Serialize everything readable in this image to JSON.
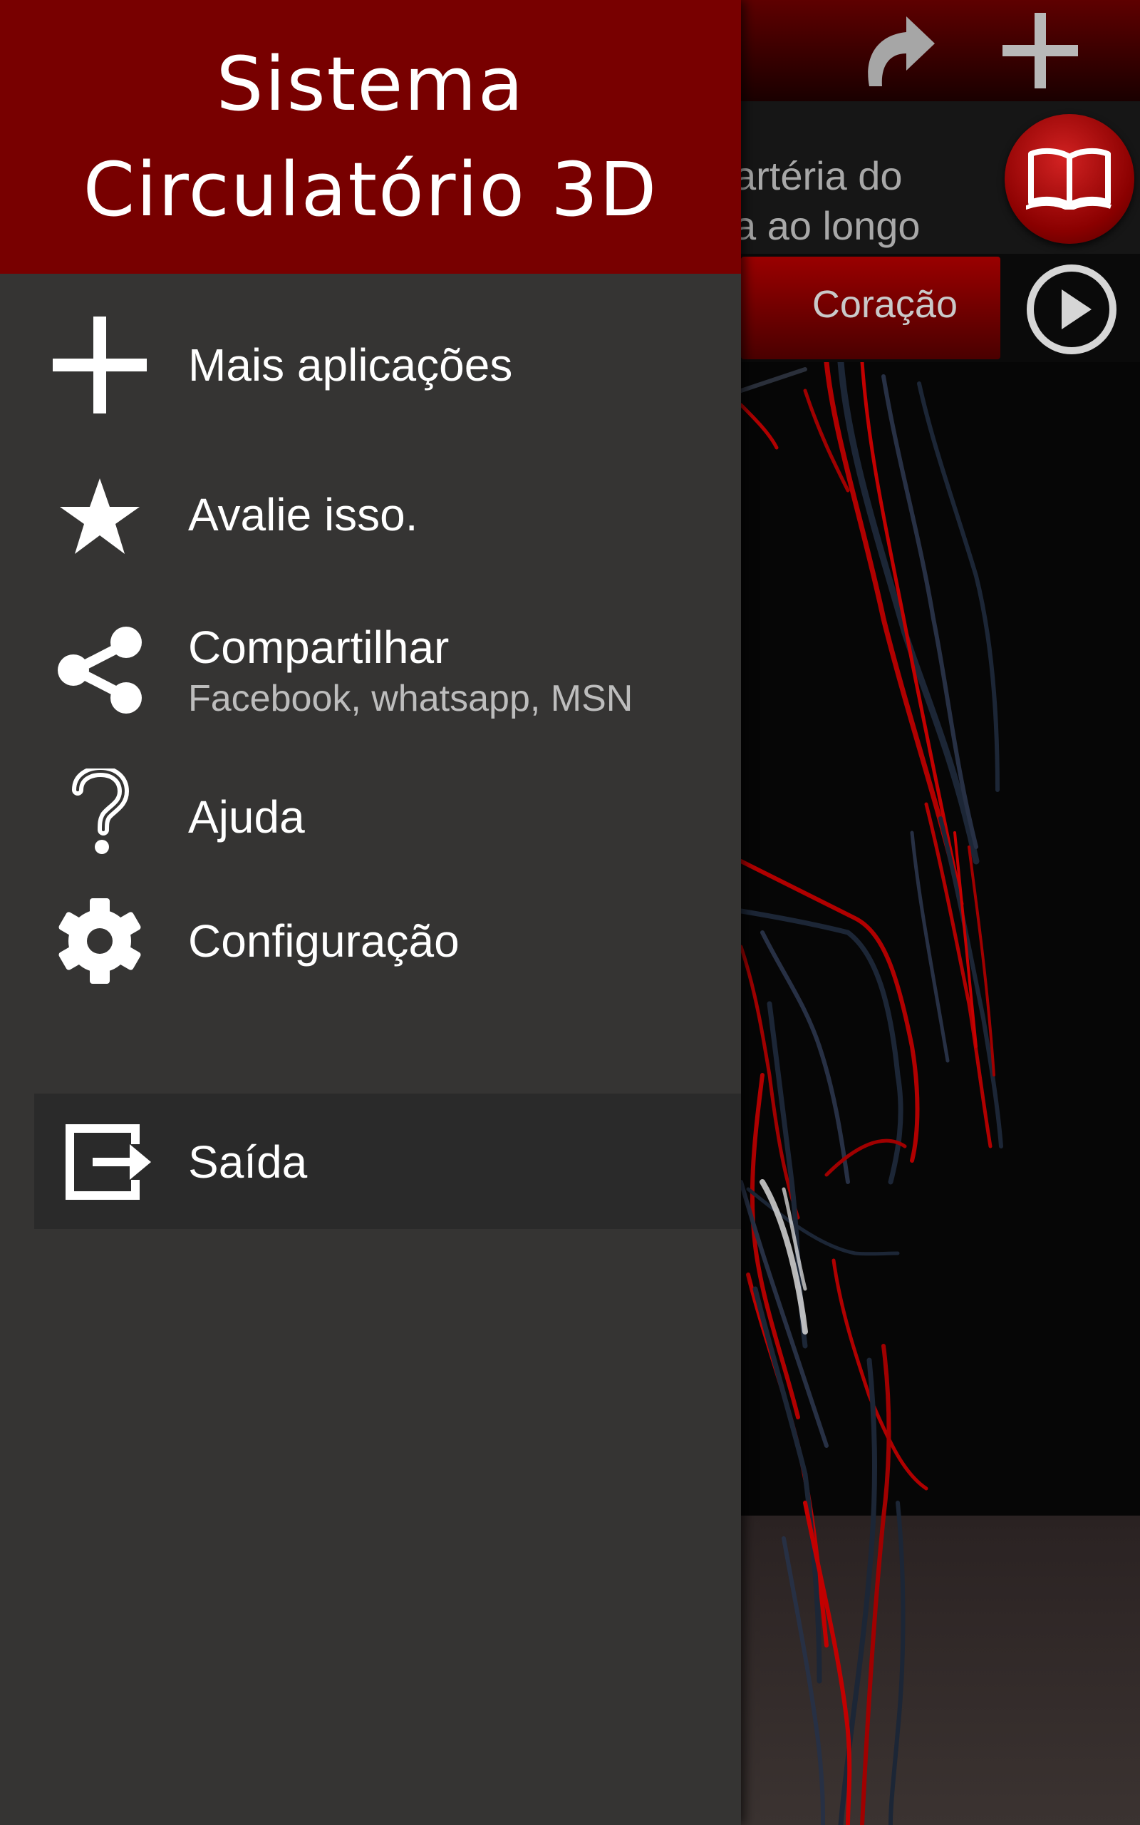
{
  "app": {
    "title": "Sistema\nCirculatório 3D"
  },
  "menu": [
    {
      "id": "more-apps",
      "label": "Mais aplicações",
      "icon": "plus-icon"
    },
    {
      "id": "rate",
      "label": "Avalie isso.",
      "icon": "star-icon"
    },
    {
      "id": "share",
      "label": "Compartilhar",
      "sublabel": "Facebook, whatsapp, MSN",
      "icon": "share-icon"
    },
    {
      "id": "help",
      "label": "Ajuda",
      "icon": "question-icon"
    },
    {
      "id": "settings",
      "label": "Configuração",
      "icon": "gear-icon"
    },
    {
      "id": "exit",
      "label": "Saída",
      "icon": "exit-icon"
    }
  ],
  "background": {
    "toolbar_icons": [
      "redo-icon",
      "plus-icon"
    ],
    "info_text": "artéria do\na ao longo",
    "info_button_icon": "book-icon",
    "tab_label": "Coração",
    "play_button_icon": "play-icon"
  },
  "colors": {
    "header": "#780000",
    "drawer": "#353433",
    "exit_highlight": "#2a2a2a",
    "accent_red": "#c00000",
    "vein_blue": "#1c2636"
  }
}
